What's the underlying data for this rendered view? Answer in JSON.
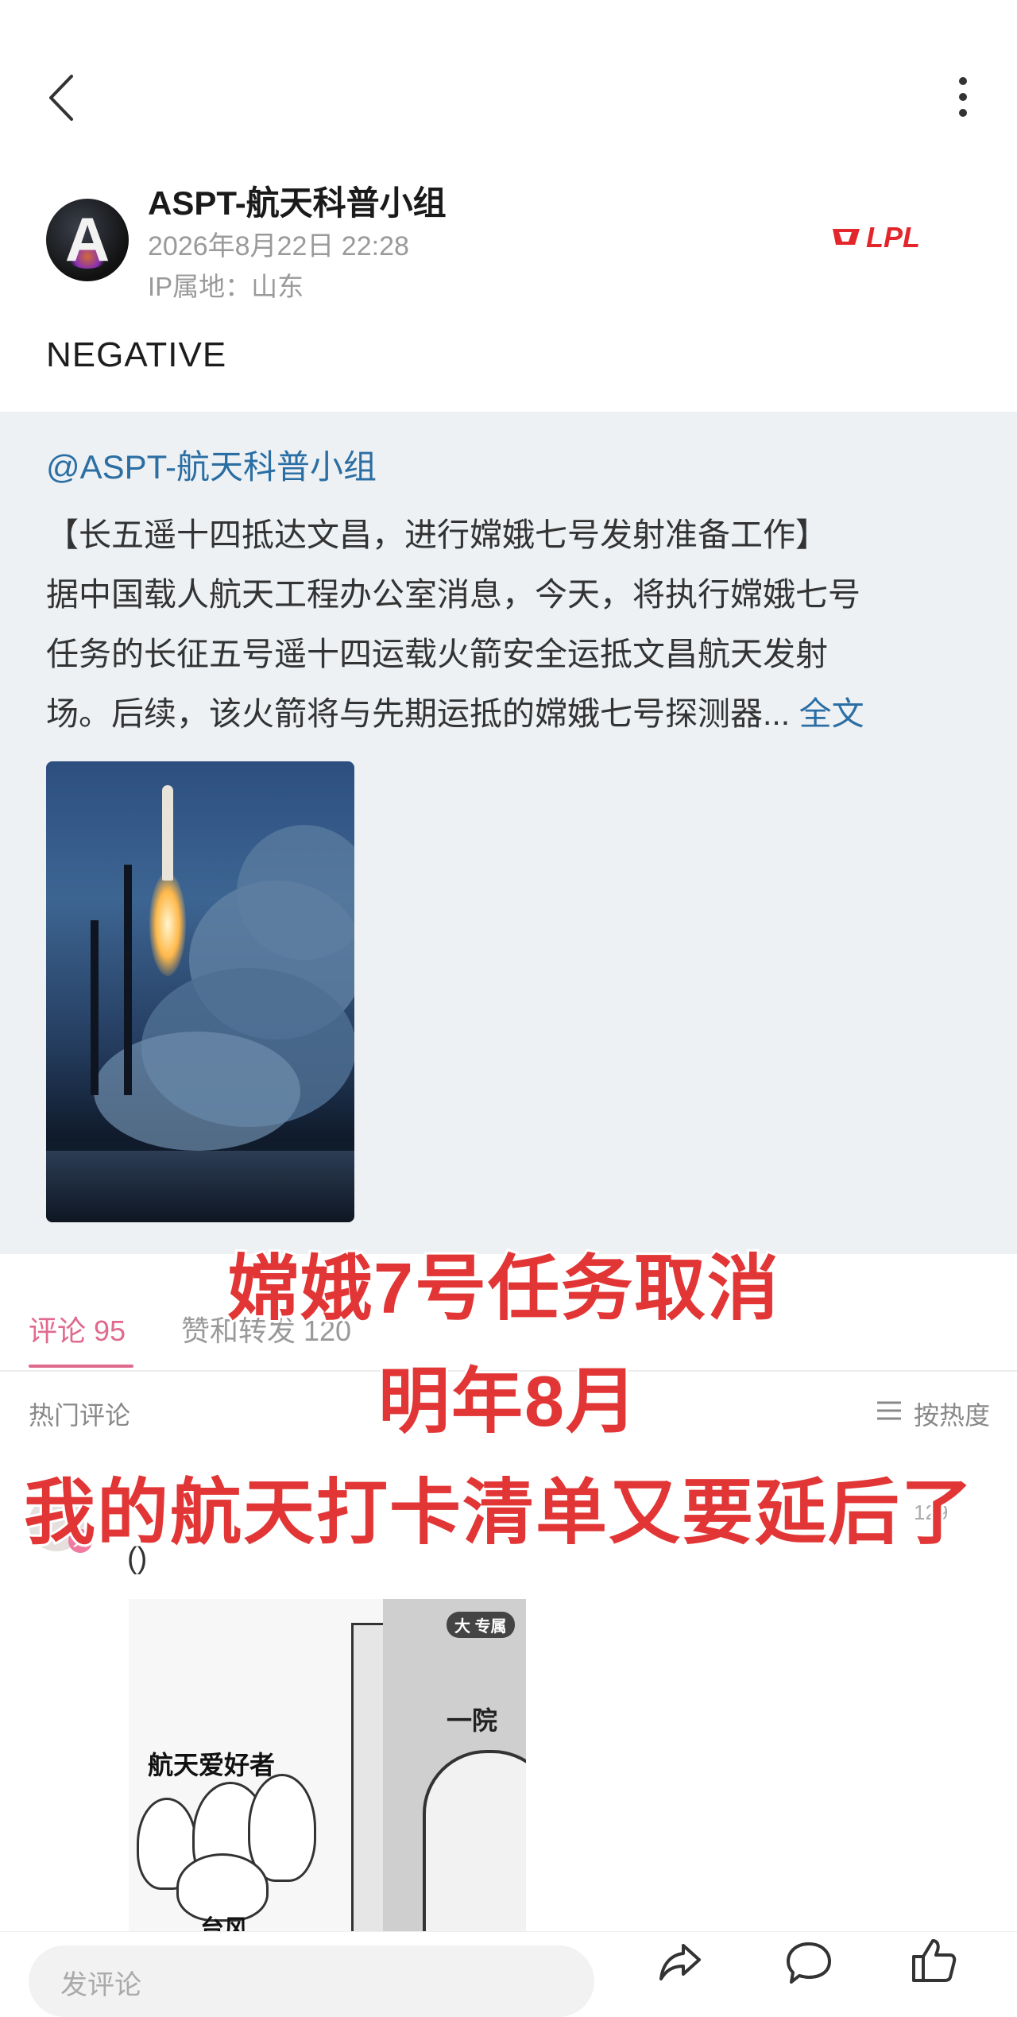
{
  "nav": {
    "back_icon": "chevron-left-icon",
    "more_icon": "vertical-dots-icon"
  },
  "post": {
    "author": "ASPT-航天科普小组",
    "date": "2026年8月22日 22:28",
    "ip": "IP属地：山东",
    "badge_text": "LPL",
    "text": "NEGATIVE"
  },
  "repost": {
    "author": "@ASPT-航天科普小组",
    "lines": [
      "【长五遥十四抵达文昌，进行嫦娥七号发射准备工作】",
      "据中国载人航天工程办公室消息，今天，将执行嫦娥七号",
      "任务的长征五号遥十四运载火箭安全运抵文昌航天发射",
      "场。后续，该火箭将与先期运抵的嫦娥七号探测器..."
    ],
    "full_link": "全文"
  },
  "tabs": {
    "comments": "评论 95",
    "likes": "赞和转发 120"
  },
  "comments_header": {
    "hot": "热门评论",
    "sort": "按热度"
  },
  "comment": {
    "text": "()",
    "avatar_badge": "大",
    "count": "129",
    "meme": {
      "tag": "专属",
      "tag_badge": "大",
      "door_label": "一院",
      "fans_label": "航天爱好者",
      "typhoon_label": "台风"
    }
  },
  "overlay": {
    "line1": "嫦娥7号任务取消",
    "line2": "明年8月",
    "line3": "我的航天打卡清单又要延后了"
  },
  "bottom": {
    "placeholder": "发评论"
  },
  "colors": {
    "accent_pink": "#e06a8e",
    "link_blue": "#2a6ea3",
    "overlay_red": "#e23535"
  }
}
